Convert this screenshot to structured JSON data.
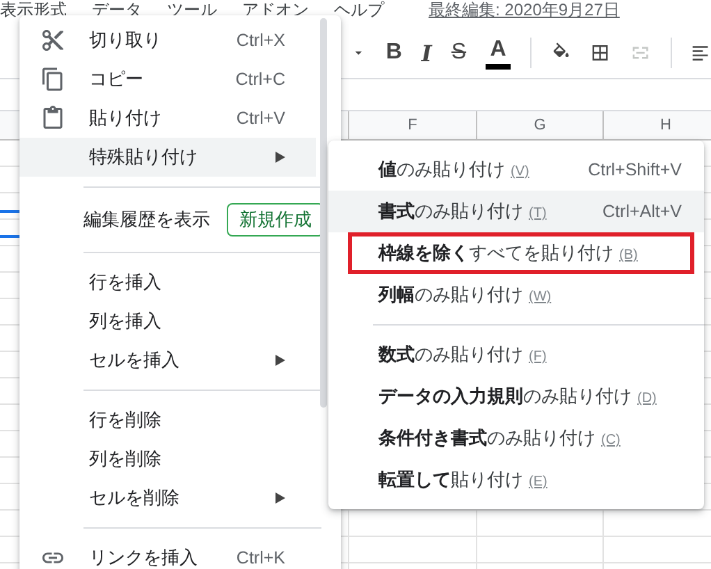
{
  "menu_bar": {
    "items": [
      "表示形式",
      "データ",
      "ツール",
      "アドオン",
      "ヘルプ"
    ],
    "last_edit": "最終編集: 2020年9月27日"
  },
  "toolbar": {
    "items": [
      {
        "kind": "caret"
      },
      {
        "kind": "bold",
        "label": "B"
      },
      {
        "kind": "italic",
        "label": "I"
      },
      {
        "kind": "strike",
        "label": "S"
      },
      {
        "kind": "textcolor",
        "label": "A"
      },
      {
        "kind": "fill"
      },
      {
        "kind": "borders"
      },
      {
        "kind": "merge",
        "disabled": true
      },
      {
        "kind": "align"
      }
    ]
  },
  "columns": [
    "F",
    "G",
    "H"
  ],
  "context_menu": {
    "items": [
      {
        "kind": "cut",
        "label": "切り取り",
        "shortcut": "Ctrl+X",
        "active": false
      },
      {
        "kind": "copy",
        "label": "コピー",
        "shortcut": "Ctrl+C",
        "active": false
      },
      {
        "kind": "paste",
        "label": "貼り付け",
        "shortcut": "Ctrl+V",
        "active": false
      },
      {
        "kind": "item",
        "label": "特殊貼り付け",
        "submenu": true,
        "active": true
      },
      {
        "kind": "divider"
      },
      {
        "kind": "history",
        "label": "編集履歴を表示",
        "button": "新規作成"
      },
      {
        "kind": "divider"
      },
      {
        "kind": "item",
        "label": "行を挿入",
        "submenu": false,
        "active": false
      },
      {
        "kind": "item",
        "label": "列を挿入",
        "submenu": false,
        "active": false
      },
      {
        "kind": "item",
        "label": "セルを挿入",
        "submenu": true,
        "active": false
      },
      {
        "kind": "divider"
      },
      {
        "kind": "item",
        "label": "行を削除",
        "submenu": false,
        "active": false
      },
      {
        "kind": "item",
        "label": "列を削除",
        "submenu": false,
        "active": false
      },
      {
        "kind": "item",
        "label": "セルを削除",
        "submenu": true,
        "active": false
      },
      {
        "kind": "divider"
      },
      {
        "kind": "link",
        "label": "リンクを挿入",
        "shortcut": "Ctrl+K",
        "active": false
      }
    ]
  },
  "paste_special_menu": {
    "items": [
      {
        "kind": "item",
        "label": "**値**のみ貼り付け",
        "mnemonic": "(V)",
        "shortcut": "Ctrl+Shift+V",
        "hovered": false,
        "highlighted": false
      },
      {
        "kind": "item",
        "label": "**書式**のみ貼り付け",
        "mnemonic": "(T)",
        "shortcut": "Ctrl+Alt+V",
        "hovered": true,
        "highlighted": false
      },
      {
        "kind": "item",
        "label": "**枠線を除く**すべてを貼り付け",
        "mnemonic": "(B)",
        "hovered": false,
        "highlighted": true
      },
      {
        "kind": "item",
        "label": "**列幅**のみ貼り付け",
        "mnemonic": "(W)",
        "hovered": false,
        "highlighted": false
      },
      {
        "kind": "divider"
      },
      {
        "kind": "item",
        "label": "**数式**のみ貼り付け",
        "mnemonic": "(F)",
        "hovered": false,
        "highlighted": false
      },
      {
        "kind": "item",
        "label": "**データの入力規則**のみ貼り付け",
        "mnemonic": "(D)",
        "hovered": false,
        "highlighted": false
      },
      {
        "kind": "item",
        "label": "**条件付き書式**のみ貼り付け",
        "mnemonic": "(C)",
        "hovered": false,
        "highlighted": false
      },
      {
        "kind": "item",
        "label": "**転置して**貼り付け",
        "mnemonic": "(E)",
        "hovered": false,
        "highlighted": false
      }
    ]
  }
}
